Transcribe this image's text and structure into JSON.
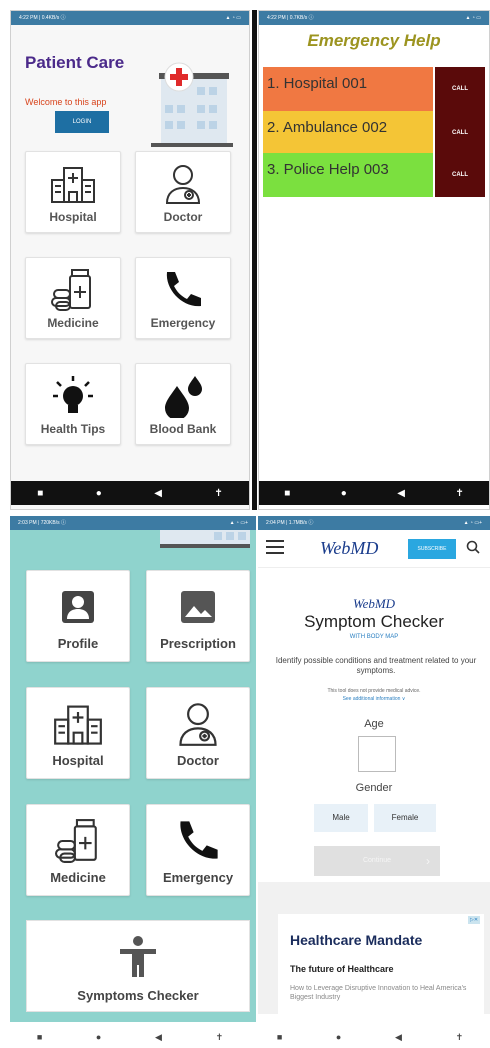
{
  "panel1": {
    "status_left": "4:22 PM | 0.4KB/s ⓘ",
    "status_right": "▲ ◔ ▭",
    "title": "Patient Care",
    "welcome": "Welcome to this app",
    "login_label": "LOGIN",
    "tiles": [
      {
        "label": "Hospital",
        "icon": "hospital-icon"
      },
      {
        "label": "Doctor",
        "icon": "doctor-icon"
      },
      {
        "label": "Medicine",
        "icon": "medicine-icon"
      },
      {
        "label": "Emergency",
        "icon": "phone-icon"
      },
      {
        "label": "Health Tips",
        "icon": "lightbulb-icon"
      },
      {
        "label": "Blood Bank",
        "icon": "blood-drop-icon"
      }
    ],
    "nav": [
      "■",
      "●",
      "◀",
      "✝"
    ]
  },
  "panel2": {
    "status_left": "4:22 PM | 0.7KB/s ⓘ",
    "status_right": "▲ ◔ ▭",
    "title": "Emergency Help",
    "rows": [
      {
        "label": "1. Hospital 001",
        "color": "#f07842",
        "call": "CALL"
      },
      {
        "label": "2. Ambulance 002",
        "color": "#f4c536",
        "call": "CALL"
      },
      {
        "label": "3. Police Help 003",
        "color": "#7be03f",
        "call": "CALL"
      }
    ],
    "nav": [
      "■",
      "●",
      "◀",
      "✝"
    ]
  },
  "panel3": {
    "status_left": "2:03 PM | 720KB/s ⓘ",
    "status_right": "▲ ◔ ▭+",
    "tiles": [
      {
        "label": "Profile",
        "icon": "profile-icon"
      },
      {
        "label": "Prescription",
        "icon": "image-icon"
      },
      {
        "label": "Hospital",
        "icon": "hospital-icon"
      },
      {
        "label": "Doctor",
        "icon": "doctor-icon"
      },
      {
        "label": "Medicine",
        "icon": "medicine-icon"
      },
      {
        "label": "Emergency",
        "icon": "phone-icon"
      }
    ],
    "symptoms_label": "Symptoms Checker"
  },
  "panel4": {
    "status_left": "2:04 PM | 1.7MB/s ⓘ",
    "status_right": "▲ ◔ ▭+",
    "logo": "WebMD",
    "subscribe_label": "SUBSCRIBE",
    "checker": {
      "logo": "WebMD",
      "title": "Symptom Checker",
      "subtitle": "WITH BODY MAP",
      "description": "Identify possible conditions and treatment related to your symptoms.",
      "note": "This tool does not provide medical advice.",
      "info_link": "See additional information ∨",
      "age_label": "Age",
      "gender_label": "Gender",
      "male_label": "Male",
      "female_label": "Female",
      "continue_label": "Continue"
    },
    "ad": {
      "marker": "▷✕",
      "title": "Healthcare Mandate",
      "subtitle": "The future of Healthcare",
      "description": "How to Leverage Disruptive Innovation to Heal America's Biggest Industry"
    }
  },
  "bottom_nav": [
    "■",
    "●",
    "◀",
    "✝",
    "■",
    "●",
    "◀",
    "✝"
  ],
  "colors": {
    "status_bar": "#3d7ba3",
    "panel3_background": "#8fd3cd",
    "call_button": "#5a0a0a"
  }
}
